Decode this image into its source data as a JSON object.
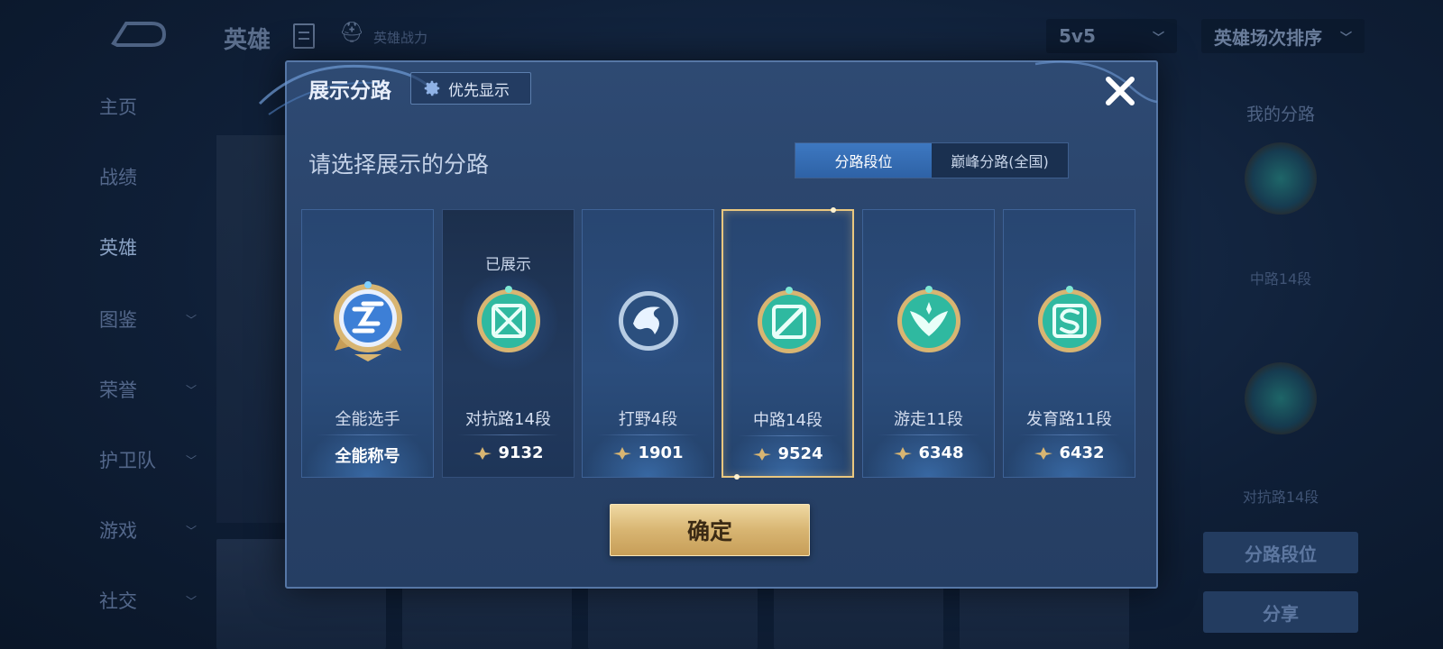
{
  "background": {
    "header_title": "英雄",
    "header_power": "英雄战力",
    "mode_select": "5v5",
    "sort_select": "英雄场次排序",
    "nav": [
      {
        "label": "主页",
        "has_chevron": false
      },
      {
        "label": "战绩",
        "has_chevron": false
      },
      {
        "label": "英雄",
        "has_chevron": false,
        "active": true
      },
      {
        "label": "图鉴",
        "has_chevron": true
      },
      {
        "label": "荣誉",
        "has_chevron": true
      },
      {
        "label": "护卫队",
        "has_chevron": true
      },
      {
        "label": "游戏",
        "has_chevron": true
      },
      {
        "label": "社交",
        "has_chevron": true
      }
    ],
    "right_panel": {
      "title": "我的分路",
      "lane1": "中路14段",
      "lane2": "对抗路14段",
      "lane_rank_button": "分路段位",
      "share_button": "分享"
    }
  },
  "modal": {
    "title": "展示分路",
    "priority_button": "优先显示",
    "prompt": "请选择展示的分路",
    "tabs": [
      {
        "label": "分路段位",
        "active": true
      },
      {
        "label": "巅峰分路(全国)",
        "active": false
      }
    ],
    "cards": [
      {
        "name": "全能选手",
        "value": "全能称号",
        "icon": "all-round-badge-icon",
        "shown_label": "",
        "selected": false,
        "shown": false,
        "show_power_icon": false,
        "color": "#3d7fd6"
      },
      {
        "name": "对抗路14段",
        "value": "9132",
        "icon": "clash-lane-badge-icon",
        "shown_label": "已展示",
        "selected": false,
        "shown": true,
        "show_power_icon": true,
        "color": "#2fb9a0"
      },
      {
        "name": "打野4段",
        "value": "1901",
        "icon": "jungle-badge-icon",
        "shown_label": "",
        "selected": false,
        "shown": false,
        "show_power_icon": true,
        "color": "#8fb3d6"
      },
      {
        "name": "中路14段",
        "value": "9524",
        "icon": "mid-lane-badge-icon",
        "shown_label": "",
        "selected": true,
        "shown": false,
        "show_power_icon": true,
        "color": "#2fb9a0"
      },
      {
        "name": "游走11段",
        "value": "6348",
        "icon": "roam-badge-icon",
        "shown_label": "",
        "selected": false,
        "shown": false,
        "show_power_icon": true,
        "color": "#2fb9a0"
      },
      {
        "name": "发育路11段",
        "value": "6432",
        "icon": "farm-lane-badge-icon",
        "shown_label": "",
        "selected": false,
        "shown": false,
        "show_power_icon": true,
        "color": "#2fb9a0"
      }
    ],
    "confirm_button": "确定"
  },
  "colors": {
    "gold": "#d8b572",
    "tab_active": "#3d78c1",
    "teal_badge": "#2fb9a0",
    "modal_bg": "#2b466d"
  }
}
